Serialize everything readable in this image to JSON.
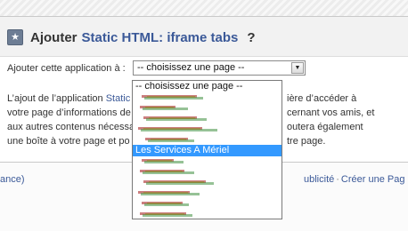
{
  "dialog": {
    "title_prefix": "Ajouter",
    "app_name": "Static HTML: iframe tabs",
    "help": "?"
  },
  "add_form": {
    "label": "Ajouter cette application à :",
    "select_value": "-- choisissez une page --",
    "arrow": "▼"
  },
  "description": {
    "line1_start": "L’ajout de l’application ",
    "line1_link": "Static H",
    "line1_end": "ière d’accéder à",
    "line2_start": "votre page d’informations de",
    "line2_end": "cernant vos amis, et",
    "line3_start": "aux autres contenus nécessa",
    "line3_end": "outera également",
    "line4_start": "une boîte à votre page et po",
    "line4_end": "tre page."
  },
  "dropdown": {
    "items": [
      {
        "label": "-- choisissez une page --",
        "redacted": false
      },
      {
        "label": "",
        "redacted": true
      },
      {
        "label": "",
        "redacted": true
      },
      {
        "label": "",
        "redacted": true
      },
      {
        "label": "",
        "redacted": true
      },
      {
        "label": "",
        "redacted": true
      },
      {
        "label": "Les Services A Mériel",
        "redacted": false,
        "selected": true
      },
      {
        "label": "",
        "redacted": true
      },
      {
        "label": "",
        "redacted": true
      },
      {
        "label": "",
        "redacted": true
      },
      {
        "label": "",
        "redacted": true
      },
      {
        "label": "",
        "redacted": true
      },
      {
        "label": "",
        "redacted": true
      }
    ]
  },
  "footer": {
    "left_text": "ance)",
    "link_publicite": "ublicité",
    "separator": "·",
    "link_create": "Créer une Pag"
  },
  "colors": {
    "link": "#3b5998",
    "selection": "#3399ff"
  }
}
